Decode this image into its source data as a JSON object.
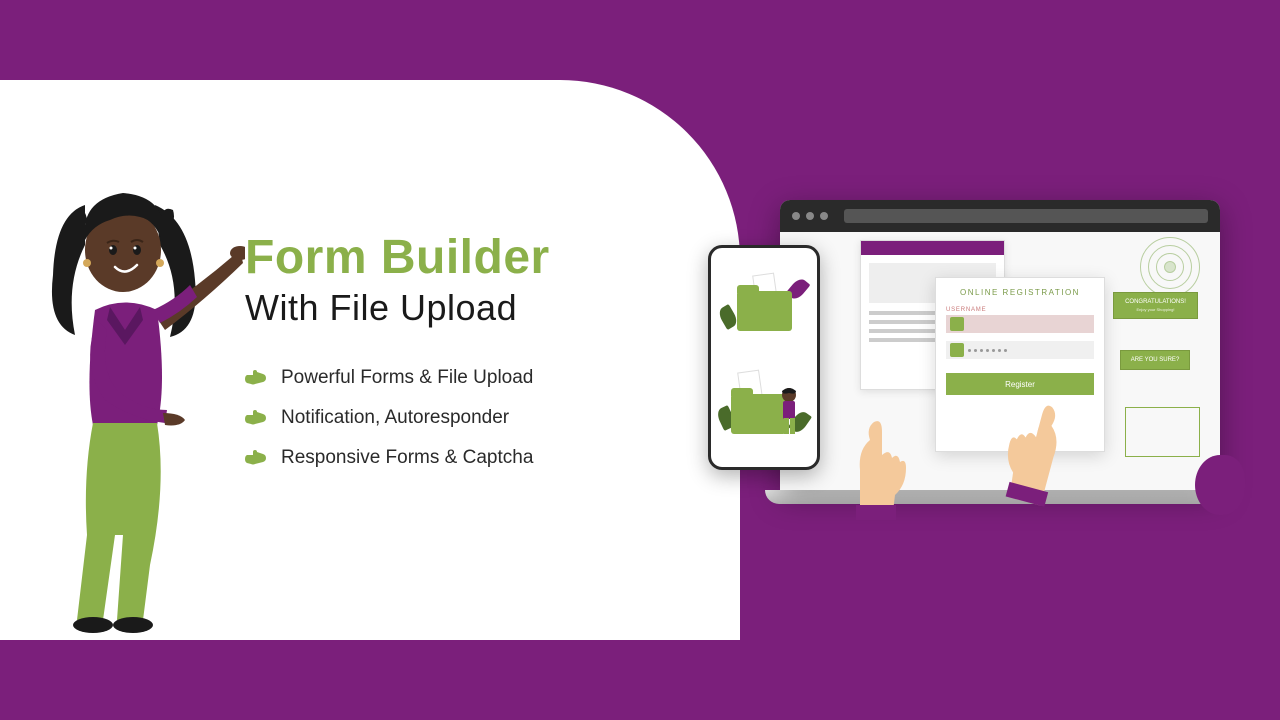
{
  "headline": {
    "main": "Form Builder",
    "sub": "With File Upload"
  },
  "features": [
    "Powerful Forms & File Upload",
    "Notification, Autoresponder",
    "Responsive Forms & Captcha"
  ],
  "mockup": {
    "form_title": "ONLINE REGISTRATION",
    "username_label": "USERNAME",
    "register_button": "Register",
    "popup_congrats": "CONGRATULATIONS!",
    "popup_congrats_sub": "Enjoy your Shopping!",
    "popup_confirm": "ARE YOU SURE?"
  },
  "colors": {
    "purple": "#7b1f7b",
    "green": "#8bb04a"
  }
}
